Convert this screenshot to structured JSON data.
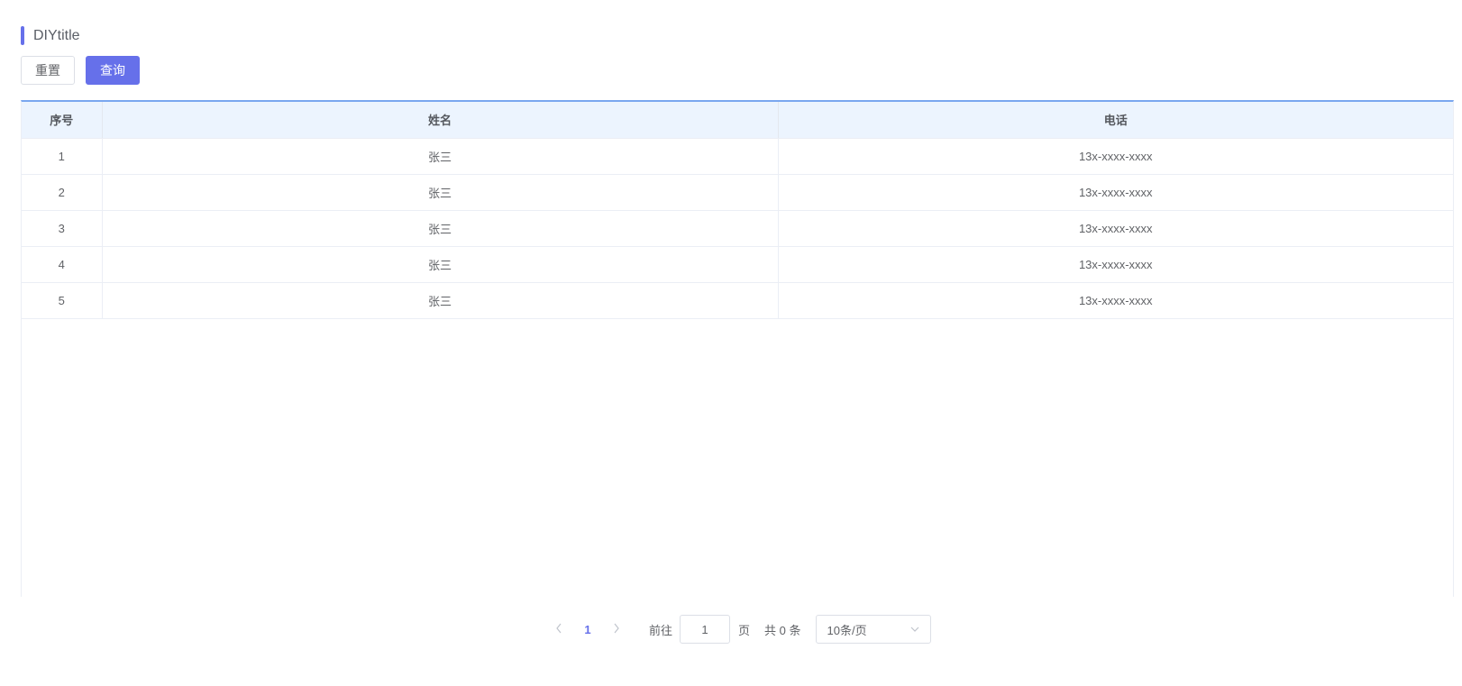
{
  "header": {
    "title": "DIYtitle"
  },
  "toolbar": {
    "reset_label": "重置",
    "query_label": "查询"
  },
  "table": {
    "columns": [
      "序号",
      "姓名",
      "电话"
    ],
    "rows": [
      [
        "1",
        "张三",
        "13x-xxxx-xxxx"
      ],
      [
        "2",
        "张三",
        "13x-xxxx-xxxx"
      ],
      [
        "3",
        "张三",
        "13x-xxxx-xxxx"
      ],
      [
        "4",
        "张三",
        "13x-xxxx-xxxx"
      ],
      [
        "5",
        "张三",
        "13x-xxxx-xxxx"
      ]
    ]
  },
  "pagination": {
    "prev_icon": "chevron-left-icon",
    "current_page": "1",
    "next_icon": "chevron-right-icon",
    "goto_label": "前往",
    "goto_value": "1",
    "page_label": "页",
    "total_label": "共 0 条",
    "page_size": "10条/页"
  },
  "colors": {
    "accent": "#6670ea",
    "table_header_bg": "#ecf4fe",
    "table_top_border": "#7aa7ef"
  }
}
